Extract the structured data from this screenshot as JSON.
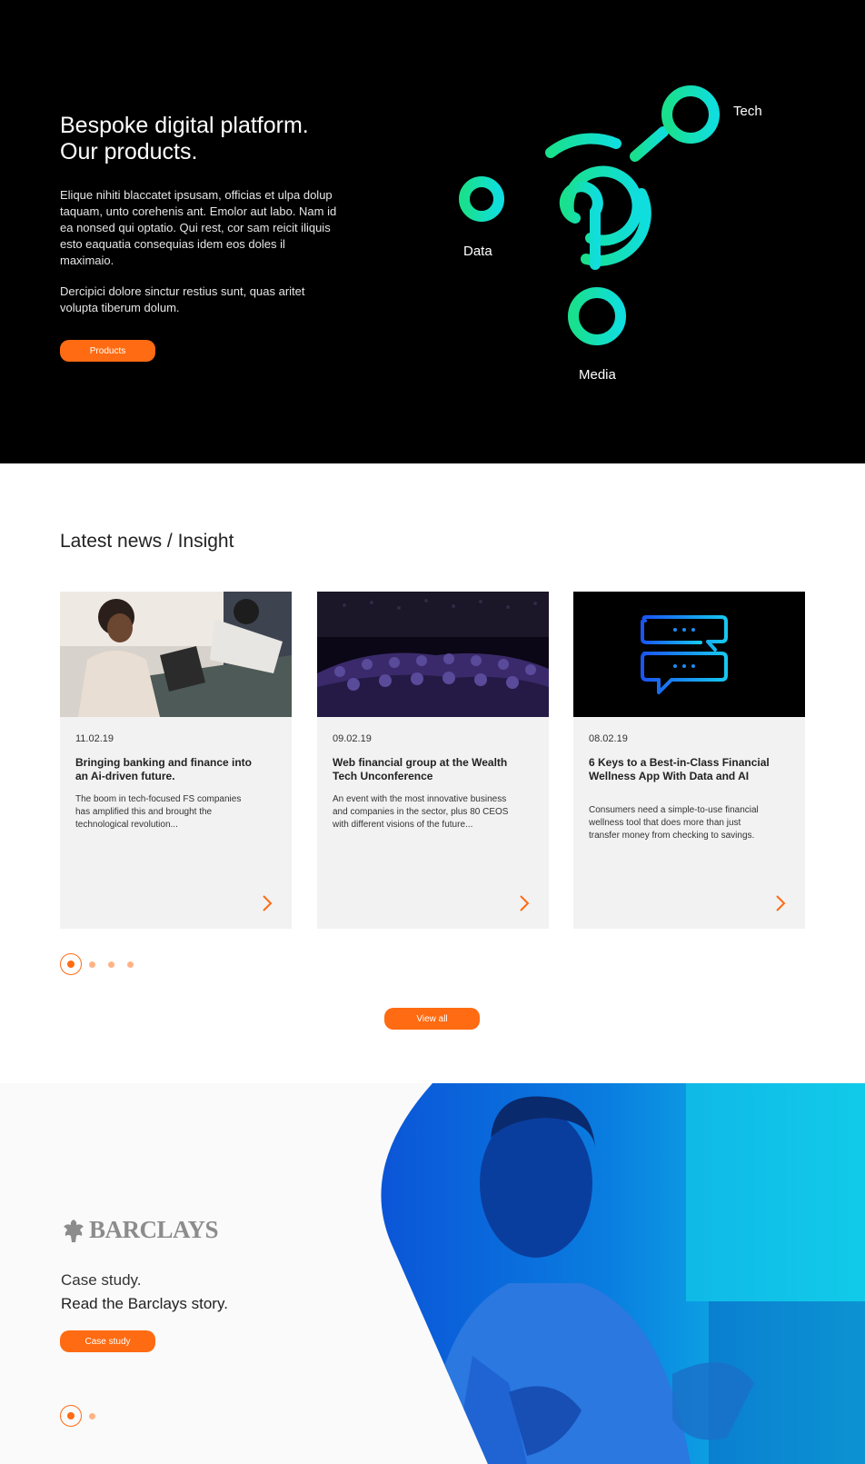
{
  "colors": {
    "accent": "#ff6b12",
    "hero_bg": "#000000",
    "card_bg": "#f2f2f2",
    "graphic_start": "#19e08c",
    "graphic_end": "#10dede"
  },
  "hero": {
    "title_line1": "Bespoke digital platform.",
    "title_line2": "Our products.",
    "paragraph1": "Elique nihiti blaccatet ipsusam, officias et ulpa dolup taquam, unto corehenis ant. Emolor aut labo. Nam id ea nonsed qui optatio. Qui rest, cor sam reicit iliquis esto eaquatia consequias idem eos doles il maximaio.",
    "paragraph2": "Dercipici dolore sinctur restius sunt, quas aritet volupta tiberum dolum.",
    "button_label": "Products",
    "graphic_labels": {
      "tech": "Tech",
      "data": "Data",
      "media": "Media"
    }
  },
  "news": {
    "title": "Latest news / Insight",
    "cards": [
      {
        "date": "11.02.19",
        "title": "Bringing banking and finance into an Ai-driven future.",
        "description": "The boom in tech-focused FS companies has amplified this and brought the technological revolution..."
      },
      {
        "date": "09.02.19",
        "title": "Web financial group at the Wealth Tech Unconference",
        "description": "An event with the most innovative business and companies in the sector, plus 80 CEOS with different visions of the future..."
      },
      {
        "date": "08.02.19",
        "title": "6 Keys to a Best-in-Class Financial Wellness App With Data and AI",
        "description": "Consumers need a simple-to-use financial wellness tool that does more than just transfer money from checking to savings."
      }
    ],
    "pagination_current": 1,
    "pagination_total": 4,
    "view_all_label": "View all"
  },
  "case_study": {
    "logo_text": "BARCLAYS",
    "line1": "Case study.",
    "line2": "Read the Barclays story.",
    "button_label": "Case study",
    "pagination_current": 1,
    "pagination_total": 2
  }
}
